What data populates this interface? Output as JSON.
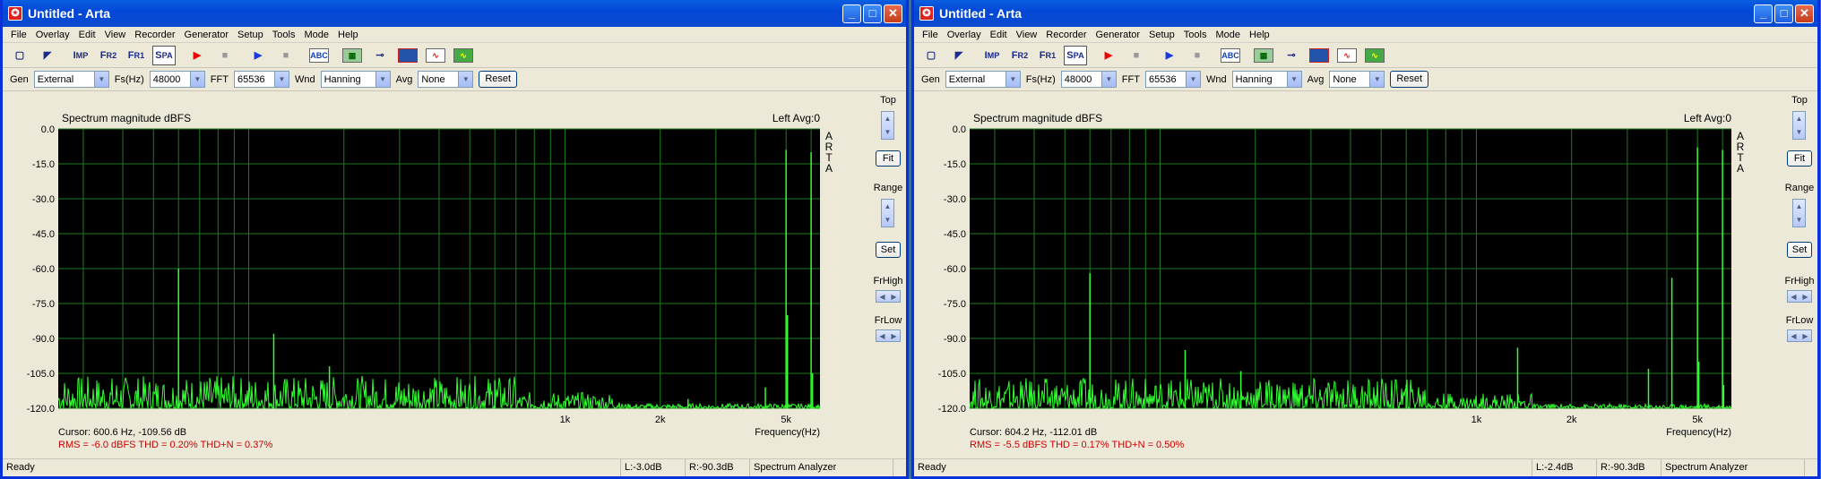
{
  "windows": [
    {
      "title": "Untitled - Arta",
      "menu": [
        "File",
        "Overlay",
        "Edit",
        "View",
        "Recorder",
        "Generator",
        "Setup",
        "Tools",
        "Mode",
        "Help"
      ],
      "params": {
        "gen_label": "Gen",
        "gen_value": "External",
        "fs_label": "Fs(Hz)",
        "fs_value": "48000",
        "fft_label": "FFT",
        "fft_value": "65536",
        "wnd_label": "Wnd",
        "wnd_value": "Hanning",
        "avg_label": "Avg",
        "avg_value": "None",
        "reset_label": "Reset"
      },
      "panel": {
        "top": "Top",
        "fit": "Fit",
        "range": "Range",
        "set": "Set",
        "frhigh": "FrHigh",
        "frlow": "FrLow"
      },
      "chart_header": "Spectrum magnitude dBFS",
      "chart_status": "Left  Avg:0",
      "arta_mark": [
        "A",
        "R",
        "T",
        "A"
      ],
      "cursor_text": "Cursor:   600.6 Hz, -109.56 dB",
      "stats_text": "RMS =  -6.0 dBFS    THD = 0.20%    THD+N = 0.37%",
      "statusbar": [
        "Ready",
        "L:-3.0dB",
        "R:-90.3dB",
        "Spectrum Analyzer"
      ],
      "chart_data": {
        "type": "line",
        "title": "Spectrum magnitude dBFS",
        "xlabel": "Frequency(Hz)",
        "x_ticks": [
          "1k",
          "2k",
          "5k"
        ],
        "y_ticks": [
          "0.0",
          "-15.0",
          "-30.0",
          "-45.0",
          "-60.0",
          "-75.0",
          "-90.0",
          "-105.0",
          "-120.0"
        ],
        "ylim": [
          -120,
          0
        ],
        "x_scale": "log",
        "grid": true,
        "peaks": [
          {
            "x": 60,
            "y": -60
          },
          {
            "x": 120,
            "y": -88
          },
          {
            "x": 180,
            "y": -102
          },
          {
            "x": 600,
            "y": -108
          },
          {
            "x": 2450,
            "y": -116
          },
          {
            "x": 4300,
            "y": -111
          },
          {
            "x": 5000,
            "y": -9
          },
          {
            "x": 5050,
            "y": -80
          },
          {
            "x": 6000,
            "y": -10
          },
          {
            "x": 6060,
            "y": -105
          }
        ],
        "noise_floor": [
          -120,
          -106
        ]
      }
    },
    {
      "title": "Untitled - Arta",
      "menu": [
        "File",
        "Overlay",
        "Edit",
        "View",
        "Recorder",
        "Generator",
        "Setup",
        "Tools",
        "Mode",
        "Help"
      ],
      "params": {
        "gen_label": "Gen",
        "gen_value": "External",
        "fs_label": "Fs(Hz)",
        "fs_value": "48000",
        "fft_label": "FFT",
        "fft_value": "65536",
        "wnd_label": "Wnd",
        "wnd_value": "Hanning",
        "avg_label": "Avg",
        "avg_value": "None",
        "reset_label": "Reset"
      },
      "panel": {
        "top": "Top",
        "fit": "Fit",
        "range": "Range",
        "set": "Set",
        "frhigh": "FrHigh",
        "frlow": "FrLow"
      },
      "chart_header": "Spectrum magnitude dBFS",
      "chart_status": "Left  Avg:0",
      "arta_mark": [
        "A",
        "R",
        "T",
        "A"
      ],
      "cursor_text": "Cursor:   604.2 Hz, -112.01 dB",
      "stats_text": "RMS =  -5.5 dBFS    THD = 0.17%    THD+N = 0.50%",
      "statusbar": [
        "Ready",
        "L:-2.4dB",
        "R:-90.3dB",
        "Spectrum Analyzer"
      ],
      "chart_data": {
        "type": "line",
        "title": "Spectrum magnitude dBFS",
        "xlabel": "Frequency(Hz)",
        "x_ticks": [
          "1k",
          "2k",
          "5k"
        ],
        "y_ticks": [
          "0.0",
          "-15.0",
          "-30.0",
          "-45.0",
          "-60.0",
          "-75.0",
          "-90.0",
          "-105.0",
          "-120.0"
        ],
        "ylim": [
          -120,
          0
        ],
        "x_scale": "log",
        "grid": true,
        "peaks": [
          {
            "x": 60,
            "y": -62
          },
          {
            "x": 120,
            "y": -95
          },
          {
            "x": 180,
            "y": -104
          },
          {
            "x": 600,
            "y": -110
          },
          {
            "x": 1350,
            "y": -94
          },
          {
            "x": 3500,
            "y": -103
          },
          {
            "x": 4150,
            "y": -64
          },
          {
            "x": 5000,
            "y": -8
          },
          {
            "x": 5050,
            "y": -100
          },
          {
            "x": 6000,
            "y": -9
          },
          {
            "x": 6050,
            "y": -110
          }
        ],
        "noise_floor": [
          -120,
          -107
        ]
      }
    }
  ]
}
